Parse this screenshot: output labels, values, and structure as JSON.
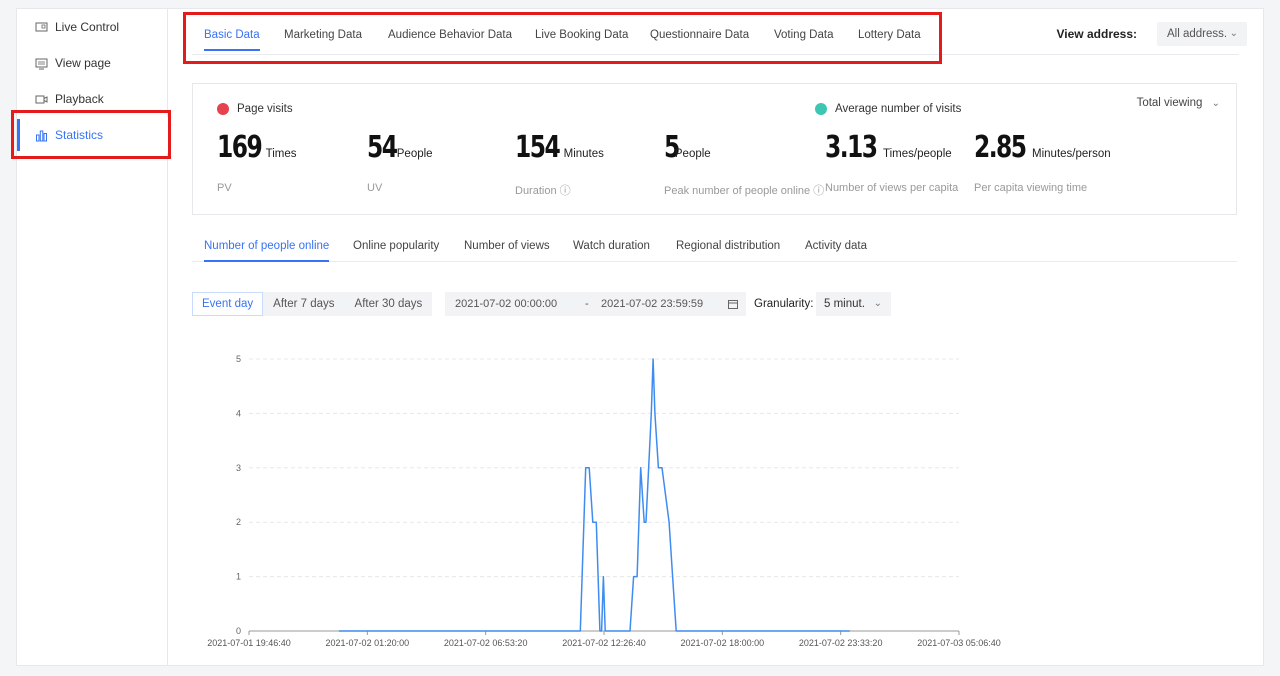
{
  "sidebar": {
    "items": [
      {
        "label": "Live Control",
        "icon": "monitor-icon",
        "active": false
      },
      {
        "label": "View page",
        "icon": "screen-icon",
        "active": false
      },
      {
        "label": "Playback",
        "icon": "video-icon",
        "active": false
      },
      {
        "label": "Statistics",
        "icon": "bar-chart-icon",
        "active": true
      }
    ]
  },
  "topnav": {
    "tabs": [
      "Basic Data",
      "Marketing Data",
      "Audience Behavior Data",
      "Live Booking Data",
      "Questionnaire Data",
      "Voting Data",
      "Lottery Data"
    ],
    "active_index": 0,
    "view_address_label": "View address:",
    "view_address_value": "All address.",
    "chevron": "⌄"
  },
  "stats": {
    "page_visits_label": "Page visits",
    "avg_visits_label": "Average number of visits",
    "total_viewing": "Total viewing",
    "metrics": [
      {
        "value": "169",
        "unit": "Times",
        "label": "PV"
      },
      {
        "value": "54",
        "unit": "People",
        "label": "UV"
      },
      {
        "value": "154",
        "unit": "Minutes",
        "label": "Duration ⓘ"
      },
      {
        "value": "5",
        "unit": "People",
        "label": "Peak number of people online ⓘ"
      },
      {
        "value": "3.13",
        "unit": "Times/people",
        "label": "Number of views per capita"
      },
      {
        "value": "2.85",
        "unit": "Minutes/person",
        "label": "Per capita viewing time"
      }
    ],
    "colors": {
      "page_visits": "#e5434f",
      "avg_visits": "#3fc6b3"
    }
  },
  "subtabs": {
    "items": [
      "Number of people online",
      "Online popularity",
      "Number of views",
      "Watch duration",
      "Regional distribution",
      "Activity data"
    ],
    "active_index": 0
  },
  "filters": {
    "ranges": [
      "Event day",
      "After 7 days",
      "After 30 days"
    ],
    "active_index": 0,
    "start": "2021-07-02 00:00:00",
    "separator": "-",
    "end": "2021-07-02 23:59:59",
    "granularity_label": "Granularity:",
    "granularity_value": "5 minut."
  },
  "chart_data": {
    "type": "line",
    "title": "",
    "xlabel": "",
    "ylabel": "",
    "ylim": [
      0,
      5
    ],
    "y_ticks": [
      0,
      1,
      2,
      3,
      4,
      5
    ],
    "x_tick_labels": [
      "2021-07-01 19:46:40",
      "2021-07-02 01:20:00",
      "2021-07-02 06:53:20",
      "2021-07-02 12:26:40",
      "2021-07-02 18:00:00",
      "2021-07-02 23:33:20",
      "2021-07-03 05:06:40"
    ],
    "grid": "horizontal dashed",
    "color": "#3f8cf0",
    "series": [
      {
        "x": [
          "2021-07-02 00:00",
          "2021-07-02 11:20",
          "2021-07-02 11:35",
          "2021-07-02 11:45",
          "2021-07-02 11:55",
          "2021-07-02 12:05",
          "2021-07-02 12:10",
          "2021-07-02 12:15",
          "2021-07-02 12:20",
          "2021-07-02 12:25",
          "2021-07-02 12:30",
          "2021-07-02 12:35",
          "2021-07-02 12:40",
          "2021-07-02 12:45",
          "2021-07-02 13:40",
          "2021-07-02 13:50",
          "2021-07-02 14:00",
          "2021-07-02 14:10",
          "2021-07-02 14:20",
          "2021-07-02 14:25",
          "2021-07-02 14:40",
          "2021-07-02 14:45",
          "2021-07-02 14:50",
          "2021-07-02 15:00",
          "2021-07-02 15:10",
          "2021-07-02 15:30",
          "2021-07-02 15:40",
          "2021-07-02 15:50",
          "2021-07-02 16:00",
          "2021-07-02 23:59"
        ],
        "y": [
          0,
          0,
          3,
          3,
          2,
          2,
          1,
          0,
          0,
          1,
          0,
          0,
          0,
          0,
          0,
          1,
          1,
          3,
          2,
          2,
          4,
          5,
          4,
          3,
          3,
          2,
          1,
          0,
          0,
          0
        ]
      }
    ]
  }
}
